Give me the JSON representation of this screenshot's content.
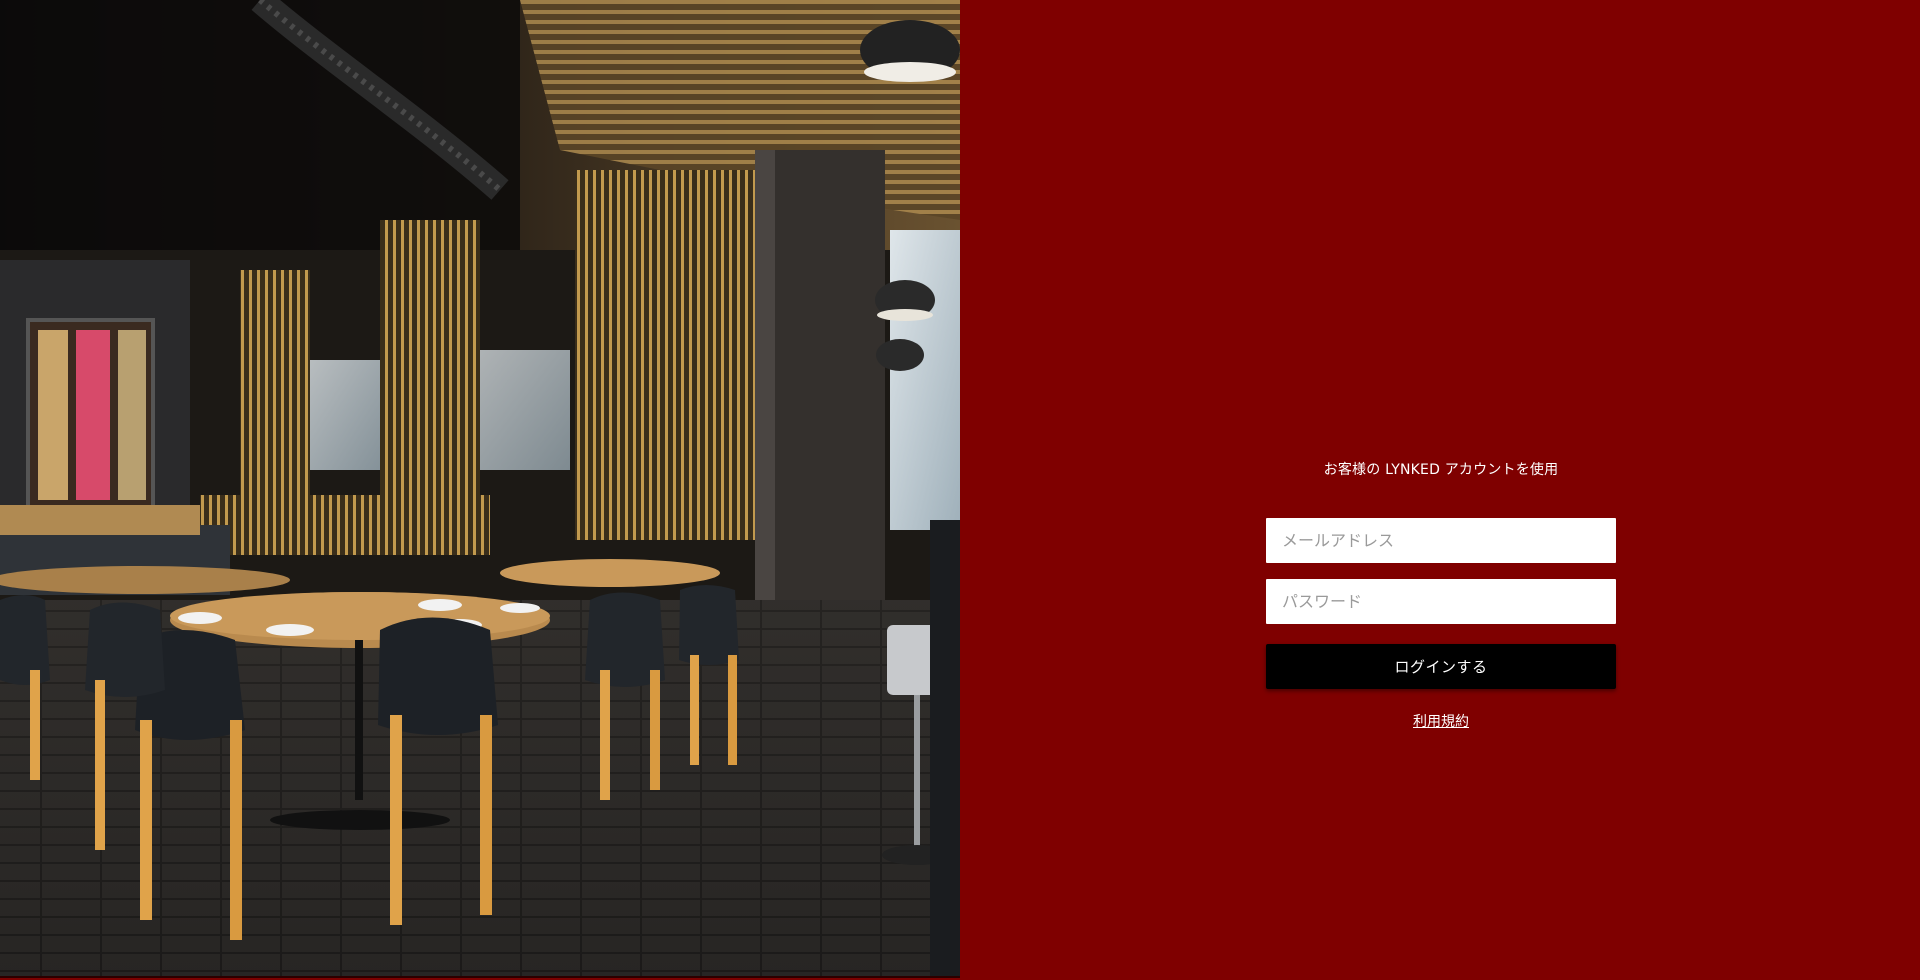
{
  "hero": {
    "image_description_icon": "restaurant-interior-photo"
  },
  "login": {
    "heading": "お客様の LYNKED アカウントを使用",
    "email_placeholder": "メールアドレス",
    "password_placeholder": "パスワード",
    "submit_label": "ログインする",
    "terms_label": "利用規約"
  },
  "colors": {
    "panel_bg": "#7f0000",
    "button_bg": "#000000",
    "text": "#ffffff"
  }
}
